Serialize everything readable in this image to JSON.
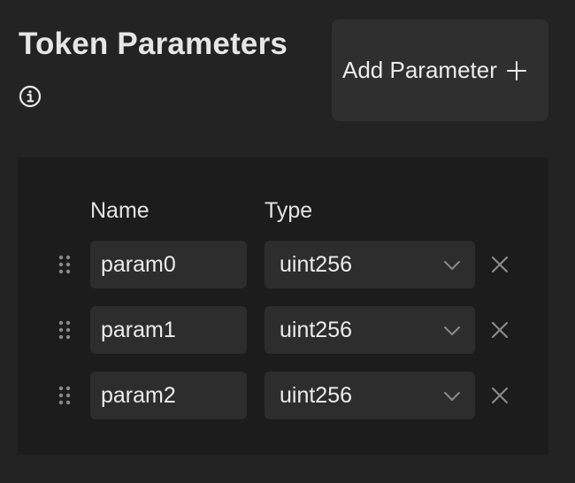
{
  "header": {
    "title": "Token Parameters",
    "info_icon": "info-icon",
    "add_button_label": "Add Parameter",
    "add_button_icon": "plus-icon"
  },
  "table": {
    "columns": {
      "name": "Name",
      "type": "Type"
    },
    "rows": [
      {
        "name": "param0",
        "type": "uint256"
      },
      {
        "name": "param1",
        "type": "uint256"
      },
      {
        "name": "param2",
        "type": "uint256"
      }
    ]
  },
  "colors": {
    "page_background": "#232323",
    "panel_background": "#1c1c1c",
    "field_background": "#2d2d2d",
    "button_background": "#2f2f2f",
    "text": "#ececec",
    "icon_muted": "#8a8a8a"
  }
}
